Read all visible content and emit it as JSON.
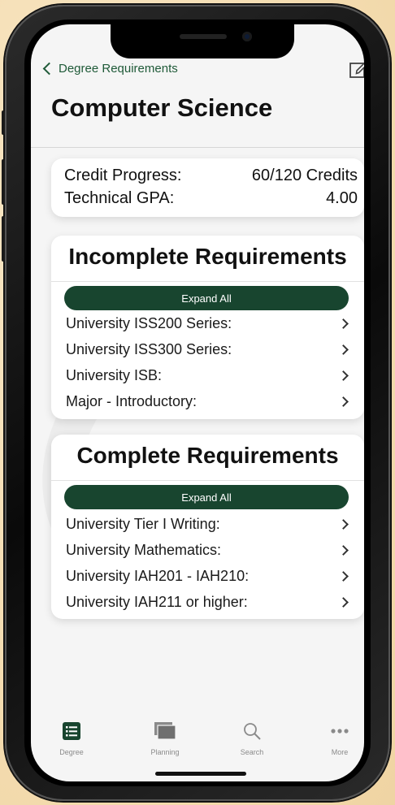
{
  "nav": {
    "back_label": "Degree Requirements"
  },
  "page": {
    "title": "Computer Science"
  },
  "summary": {
    "credit_label": "Credit Progress:",
    "credit_value": "60/120 Credits",
    "gpa_label": "Technical GPA:",
    "gpa_value": "4.00"
  },
  "incomplete": {
    "title": "Incomplete Requirements",
    "expand_label": "Expand All",
    "items": [
      {
        "label": "University ISS200 Series:"
      },
      {
        "label": "University ISS300 Series:"
      },
      {
        "label": "University ISB:"
      },
      {
        "label": "Major - Introductory:"
      }
    ]
  },
  "complete": {
    "title": "Complete Requirements",
    "expand_label": "Expand All",
    "items": [
      {
        "label": "University Tier I Writing:"
      },
      {
        "label": "University Mathematics:"
      },
      {
        "label": "University IAH201 - IAH210:"
      },
      {
        "label": "University IAH211 or higher:"
      }
    ]
  },
  "tabs": [
    {
      "label": "Degree",
      "icon": "list-icon",
      "active": true
    },
    {
      "label": "Planning",
      "icon": "stack-icon",
      "active": false
    },
    {
      "label": "Search",
      "icon": "search-icon",
      "active": false
    },
    {
      "label": "More",
      "icon": "more-icon",
      "active": false
    }
  ],
  "colors": {
    "accent": "#18452f",
    "link": "#1f5a38",
    "inactive": "#8a8a8a"
  }
}
